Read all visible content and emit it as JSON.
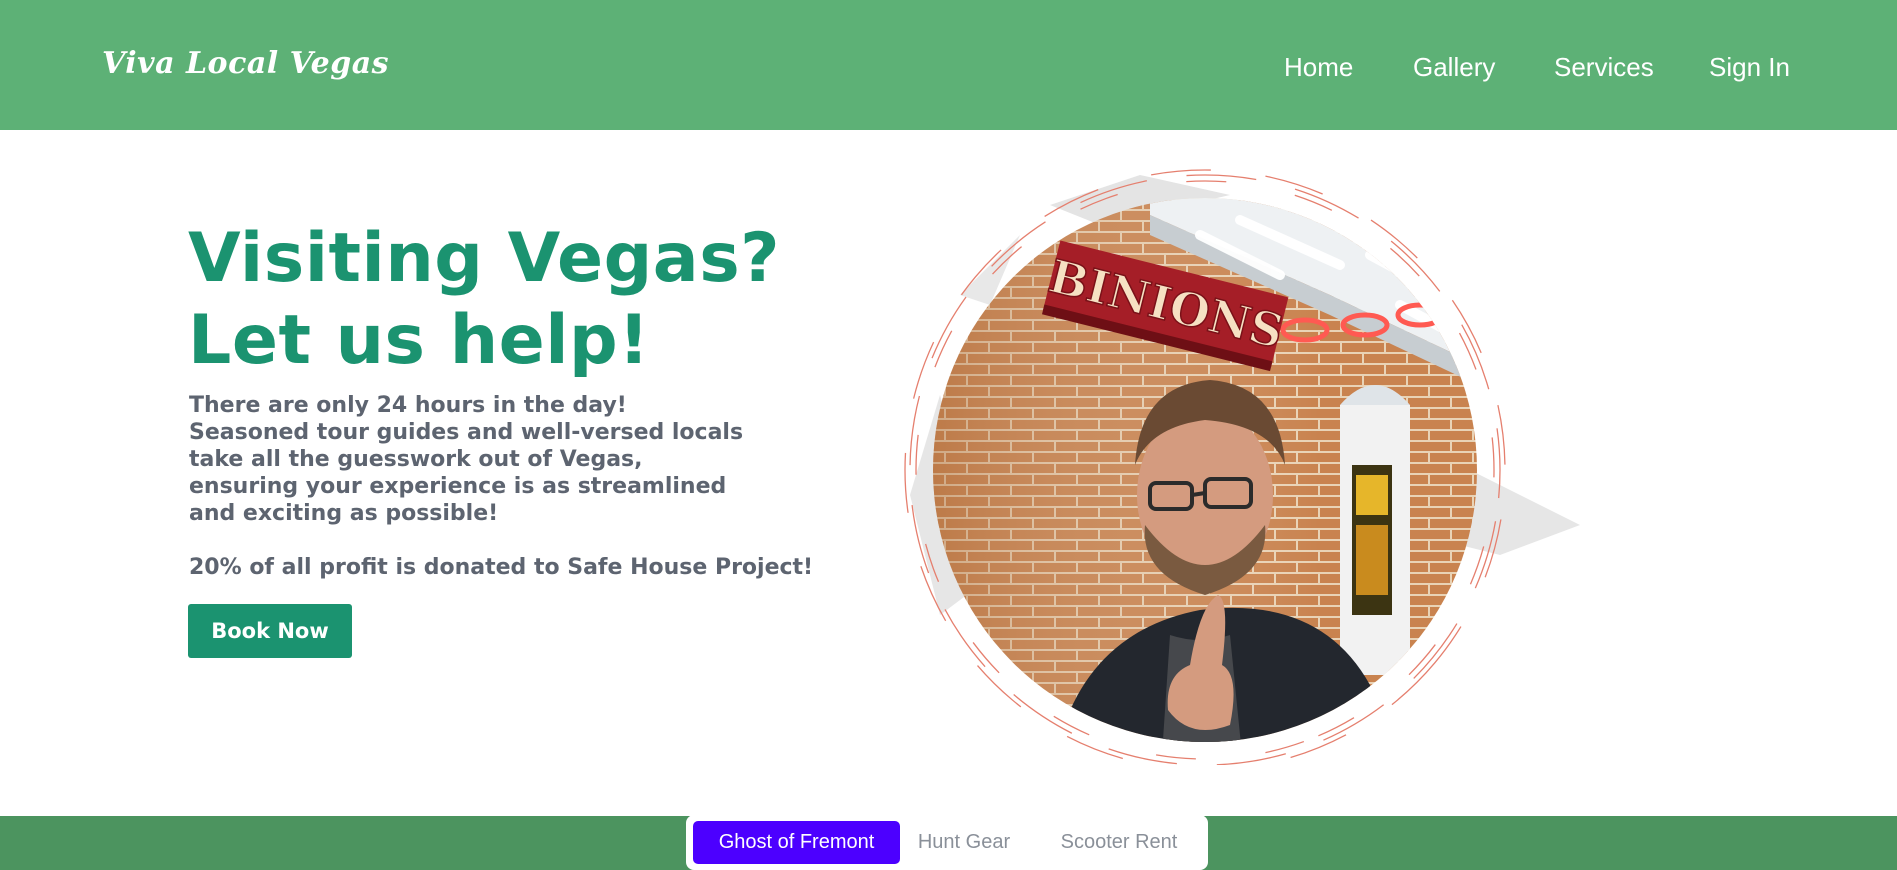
{
  "header": {
    "logo": "Viva Local Vegas",
    "nav": [
      "Home",
      "Gallery",
      "Services",
      "Sign In"
    ]
  },
  "hero": {
    "title_line1": "Visiting Vegas?",
    "title_line2": "Let us help!",
    "body": "There are only 24 hours in the day! Seasoned tour guides and well-versed locals take all the guesswork out of Vegas, ensuring your experience is as streamlined and exciting as possible!",
    "donation": "20% of all profit is donated to Safe House Project!",
    "button": "Book Now",
    "photo_sign": "BINIONS"
  },
  "tabs": {
    "items": [
      "Ghost of Fremont",
      "Hunt Gear",
      "Scooter Rent"
    ],
    "active_index": 0
  },
  "colors": {
    "header_green": "#5db176",
    "footer_green": "#4c945f",
    "accent_teal": "#1b9370",
    "body_text": "#5d6470",
    "active_tab": "#4c00ff"
  }
}
